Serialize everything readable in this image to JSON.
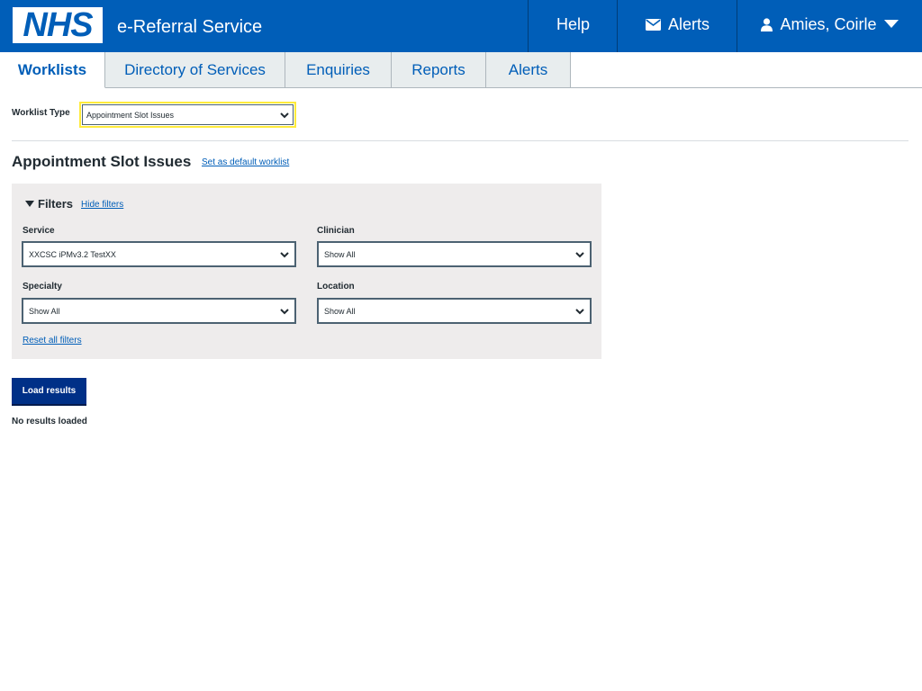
{
  "header": {
    "logo_text": "NHS",
    "service_name": "e-Referral Service",
    "help_label": "Help",
    "alerts_label": "Alerts",
    "user_name": "Amies, Coirle",
    "brand_color": "#005eb8"
  },
  "tabs": [
    {
      "label": "Worklists",
      "active": true
    },
    {
      "label": "Directory of Services",
      "active": false
    },
    {
      "label": "Enquiries",
      "active": false
    },
    {
      "label": "Reports",
      "active": false
    },
    {
      "label": "Alerts",
      "active": false
    }
  ],
  "worklist": {
    "type_label": "Worklist Type",
    "type_value": "Appointment Slot Issues",
    "page_title": "Appointment Slot Issues",
    "set_default_link": "Set as default worklist"
  },
  "filters": {
    "toggle_label": "Filters",
    "hide_link": "Hide filters",
    "service": {
      "label": "Service",
      "value": "XXCSC iPMv3.2 TestXX"
    },
    "clinician": {
      "label": "Clinician",
      "value": "Show All"
    },
    "specialty": {
      "label": "Specialty",
      "value": "Show All"
    },
    "location": {
      "label": "Location",
      "value": "Show All"
    },
    "reset_link": "Reset all filters"
  },
  "actions": {
    "load_results": "Load results",
    "status_text": "No results loaded"
  },
  "icons": {
    "alerts": "envelope-icon",
    "user": "user-icon",
    "user_menu": "caret-down-icon",
    "select": "chevron-down-icon",
    "filters_toggle": "triangle-down-icon"
  }
}
